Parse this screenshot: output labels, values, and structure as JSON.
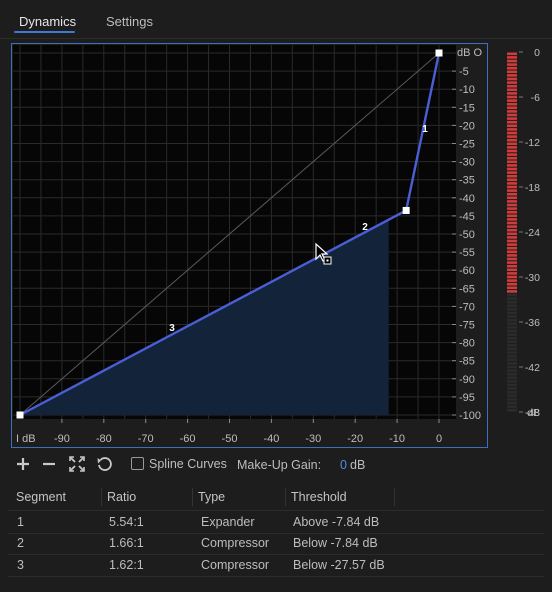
{
  "tabs": [
    {
      "label": "Dynamics",
      "active": true
    },
    {
      "label": "Settings",
      "active": false
    }
  ],
  "graph": {
    "right_axis_unit": "dB O",
    "right_axis_ticks": [
      "-5",
      "-10",
      "-15",
      "-20",
      "-25",
      "-30",
      "-35",
      "-40",
      "-45",
      "-50",
      "-55",
      "-60",
      "-65",
      "-70",
      "-75",
      "-80",
      "-85",
      "-90",
      "-95",
      "-100"
    ],
    "bottom_axis_unit": "I dB",
    "bottom_axis_ticks": [
      "-90",
      "-80",
      "-70",
      "-60",
      "-50",
      "-40",
      "-30",
      "-20",
      "-10",
      "0"
    ],
    "curve_points": [
      {
        "in": -100,
        "out": -100
      },
      {
        "in": -7.84,
        "out": -43.5
      },
      {
        "in": 0,
        "out": 0
      }
    ],
    "segment_labels": [
      "1",
      "2",
      "3"
    ],
    "colors": {
      "curve": "#4a5fd6",
      "fill": "#13243a",
      "grid": "#2a2a2a",
      "background": "#060606",
      "border": "#3d6fbf"
    }
  },
  "meter": {
    "ticks": [
      "0",
      "-6",
      "-12",
      "-18",
      "-24",
      "-30",
      "-36",
      "-42",
      "-48"
    ],
    "unit": "dB",
    "level": -32,
    "colors": {
      "active": "#d03c3c",
      "inactive": "#2b2b2b"
    }
  },
  "toolbar": {
    "icons": [
      "add-icon",
      "remove-icon",
      "fit-icon",
      "reset-icon"
    ],
    "spline_label": "Spline Curves",
    "spline_checked": false,
    "makeup_label": "Make-Up Gain:",
    "makeup_value": "0",
    "makeup_unit": "dB"
  },
  "table": {
    "headers": [
      "Segment",
      "Ratio",
      "Type",
      "Threshold"
    ],
    "rows": [
      {
        "segment": "1",
        "ratio": "5.54:1",
        "type": "Expander",
        "threshold": "Above -7.84 dB"
      },
      {
        "segment": "2",
        "ratio": "1.66:1",
        "type": "Compressor",
        "threshold": "Below -7.84 dB"
      },
      {
        "segment": "3",
        "ratio": "1.62:1",
        "type": "Compressor",
        "threshold": "Below -27.57 dB"
      }
    ]
  }
}
